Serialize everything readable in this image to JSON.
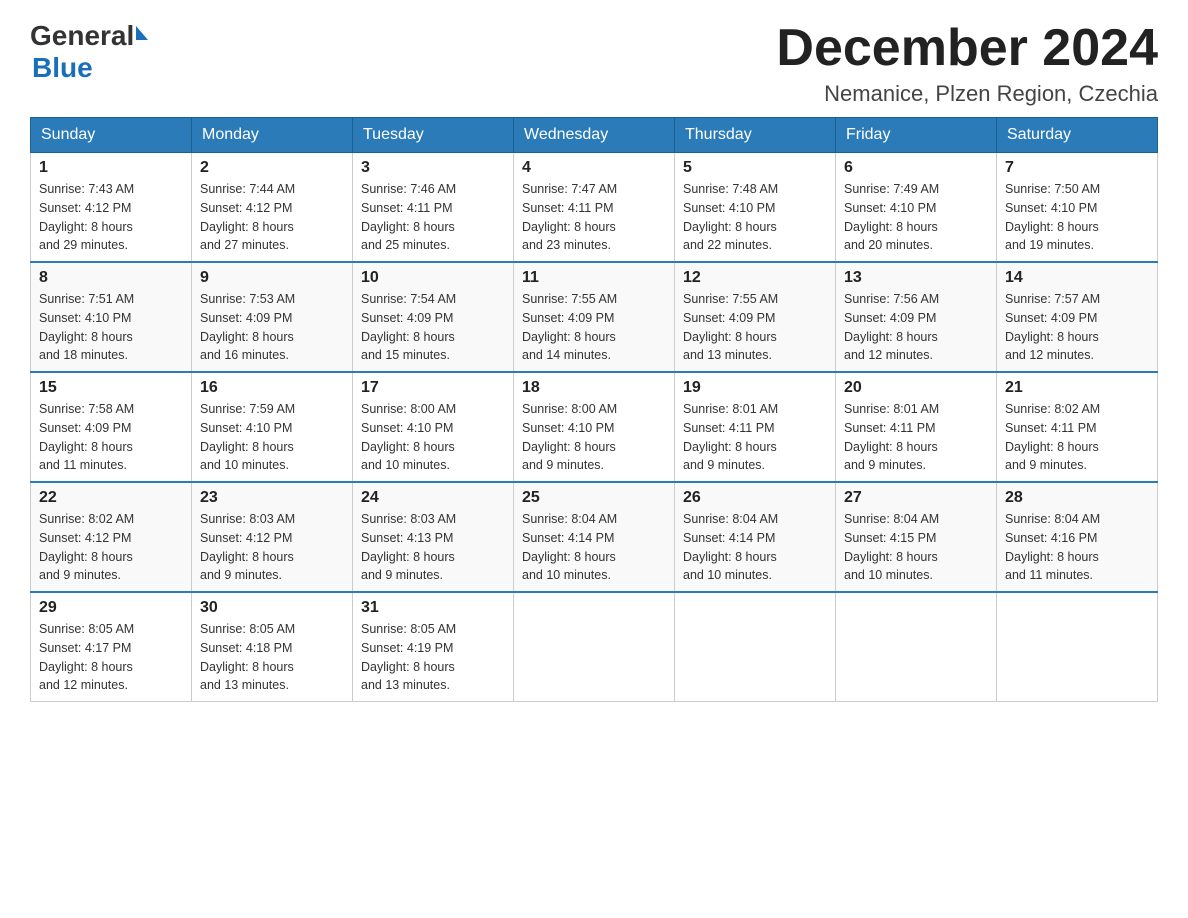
{
  "header": {
    "logo_general": "General",
    "logo_blue": "Blue",
    "title": "December 2024",
    "subtitle": "Nemanice, Plzen Region, Czechia"
  },
  "days_of_week": [
    "Sunday",
    "Monday",
    "Tuesday",
    "Wednesday",
    "Thursday",
    "Friday",
    "Saturday"
  ],
  "weeks": [
    [
      {
        "day": "1",
        "sunrise": "7:43 AM",
        "sunset": "4:12 PM",
        "daylight": "8 hours and 29 minutes."
      },
      {
        "day": "2",
        "sunrise": "7:44 AM",
        "sunset": "4:12 PM",
        "daylight": "8 hours and 27 minutes."
      },
      {
        "day": "3",
        "sunrise": "7:46 AM",
        "sunset": "4:11 PM",
        "daylight": "8 hours and 25 minutes."
      },
      {
        "day": "4",
        "sunrise": "7:47 AM",
        "sunset": "4:11 PM",
        "daylight": "8 hours and 23 minutes."
      },
      {
        "day": "5",
        "sunrise": "7:48 AM",
        "sunset": "4:10 PM",
        "daylight": "8 hours and 22 minutes."
      },
      {
        "day": "6",
        "sunrise": "7:49 AM",
        "sunset": "4:10 PM",
        "daylight": "8 hours and 20 minutes."
      },
      {
        "day": "7",
        "sunrise": "7:50 AM",
        "sunset": "4:10 PM",
        "daylight": "8 hours and 19 minutes."
      }
    ],
    [
      {
        "day": "8",
        "sunrise": "7:51 AM",
        "sunset": "4:10 PM",
        "daylight": "8 hours and 18 minutes."
      },
      {
        "day": "9",
        "sunrise": "7:53 AM",
        "sunset": "4:09 PM",
        "daylight": "8 hours and 16 minutes."
      },
      {
        "day": "10",
        "sunrise": "7:54 AM",
        "sunset": "4:09 PM",
        "daylight": "8 hours and 15 minutes."
      },
      {
        "day": "11",
        "sunrise": "7:55 AM",
        "sunset": "4:09 PM",
        "daylight": "8 hours and 14 minutes."
      },
      {
        "day": "12",
        "sunrise": "7:55 AM",
        "sunset": "4:09 PM",
        "daylight": "8 hours and 13 minutes."
      },
      {
        "day": "13",
        "sunrise": "7:56 AM",
        "sunset": "4:09 PM",
        "daylight": "8 hours and 12 minutes."
      },
      {
        "day": "14",
        "sunrise": "7:57 AM",
        "sunset": "4:09 PM",
        "daylight": "8 hours and 12 minutes."
      }
    ],
    [
      {
        "day": "15",
        "sunrise": "7:58 AM",
        "sunset": "4:09 PM",
        "daylight": "8 hours and 11 minutes."
      },
      {
        "day": "16",
        "sunrise": "7:59 AM",
        "sunset": "4:10 PM",
        "daylight": "8 hours and 10 minutes."
      },
      {
        "day": "17",
        "sunrise": "8:00 AM",
        "sunset": "4:10 PM",
        "daylight": "8 hours and 10 minutes."
      },
      {
        "day": "18",
        "sunrise": "8:00 AM",
        "sunset": "4:10 PM",
        "daylight": "8 hours and 9 minutes."
      },
      {
        "day": "19",
        "sunrise": "8:01 AM",
        "sunset": "4:11 PM",
        "daylight": "8 hours and 9 minutes."
      },
      {
        "day": "20",
        "sunrise": "8:01 AM",
        "sunset": "4:11 PM",
        "daylight": "8 hours and 9 minutes."
      },
      {
        "day": "21",
        "sunrise": "8:02 AM",
        "sunset": "4:11 PM",
        "daylight": "8 hours and 9 minutes."
      }
    ],
    [
      {
        "day": "22",
        "sunrise": "8:02 AM",
        "sunset": "4:12 PM",
        "daylight": "8 hours and 9 minutes."
      },
      {
        "day": "23",
        "sunrise": "8:03 AM",
        "sunset": "4:12 PM",
        "daylight": "8 hours and 9 minutes."
      },
      {
        "day": "24",
        "sunrise": "8:03 AM",
        "sunset": "4:13 PM",
        "daylight": "8 hours and 9 minutes."
      },
      {
        "day": "25",
        "sunrise": "8:04 AM",
        "sunset": "4:14 PM",
        "daylight": "8 hours and 10 minutes."
      },
      {
        "day": "26",
        "sunrise": "8:04 AM",
        "sunset": "4:14 PM",
        "daylight": "8 hours and 10 minutes."
      },
      {
        "day": "27",
        "sunrise": "8:04 AM",
        "sunset": "4:15 PM",
        "daylight": "8 hours and 10 minutes."
      },
      {
        "day": "28",
        "sunrise": "8:04 AM",
        "sunset": "4:16 PM",
        "daylight": "8 hours and 11 minutes."
      }
    ],
    [
      {
        "day": "29",
        "sunrise": "8:05 AM",
        "sunset": "4:17 PM",
        "daylight": "8 hours and 12 minutes."
      },
      {
        "day": "30",
        "sunrise": "8:05 AM",
        "sunset": "4:18 PM",
        "daylight": "8 hours and 13 minutes."
      },
      {
        "day": "31",
        "sunrise": "8:05 AM",
        "sunset": "4:19 PM",
        "daylight": "8 hours and 13 minutes."
      },
      null,
      null,
      null,
      null
    ]
  ],
  "labels": {
    "sunrise_prefix": "Sunrise: ",
    "sunset_prefix": "Sunset: ",
    "daylight_prefix": "Daylight: "
  }
}
